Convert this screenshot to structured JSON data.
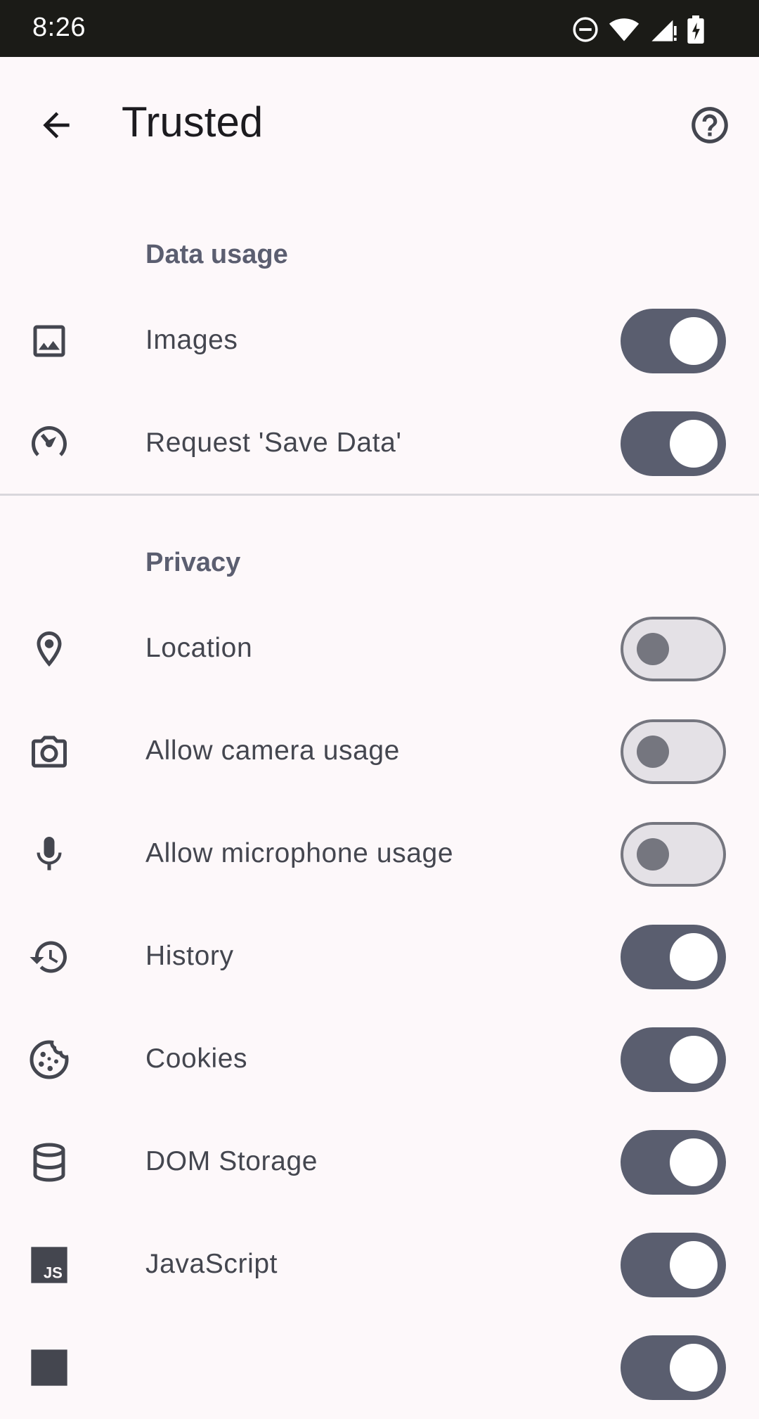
{
  "status_bar": {
    "time": "8:26",
    "icons": [
      "do-not-disturb-icon",
      "wifi-icon",
      "signal-icon",
      "battery-charging-icon"
    ]
  },
  "app_bar": {
    "title": "Trusted",
    "back_icon": "arrow-back-icon",
    "help_icon": "help-circle-icon"
  },
  "sections": {
    "data_usage": {
      "header": "Data usage",
      "items": [
        {
          "label": "Images",
          "icon": "image-icon",
          "enabled": true
        },
        {
          "label": "Request 'Save Data'",
          "icon": "speedometer-icon",
          "enabled": true
        }
      ]
    },
    "privacy": {
      "header": "Privacy",
      "items": [
        {
          "label": "Location",
          "icon": "location-pin-icon",
          "enabled": false
        },
        {
          "label": "Allow camera usage",
          "icon": "camera-icon",
          "enabled": false
        },
        {
          "label": "Allow microphone usage",
          "icon": "microphone-icon",
          "enabled": false
        },
        {
          "label": "History",
          "icon": "history-icon",
          "enabled": true
        },
        {
          "label": "Cookies",
          "icon": "cookie-icon",
          "enabled": true
        },
        {
          "label": "DOM Storage",
          "icon": "database-icon",
          "enabled": true
        },
        {
          "label": "JavaScript",
          "icon": "javascript-icon",
          "enabled": true
        }
      ]
    }
  },
  "colors": {
    "background": "#fdf8fa",
    "status_bar": "#1b1b17",
    "toggle_on_track": "#5a5e6f",
    "toggle_off_track": "#e4e1e6",
    "section_header": "#5b5e70",
    "icon": "#44464f"
  }
}
